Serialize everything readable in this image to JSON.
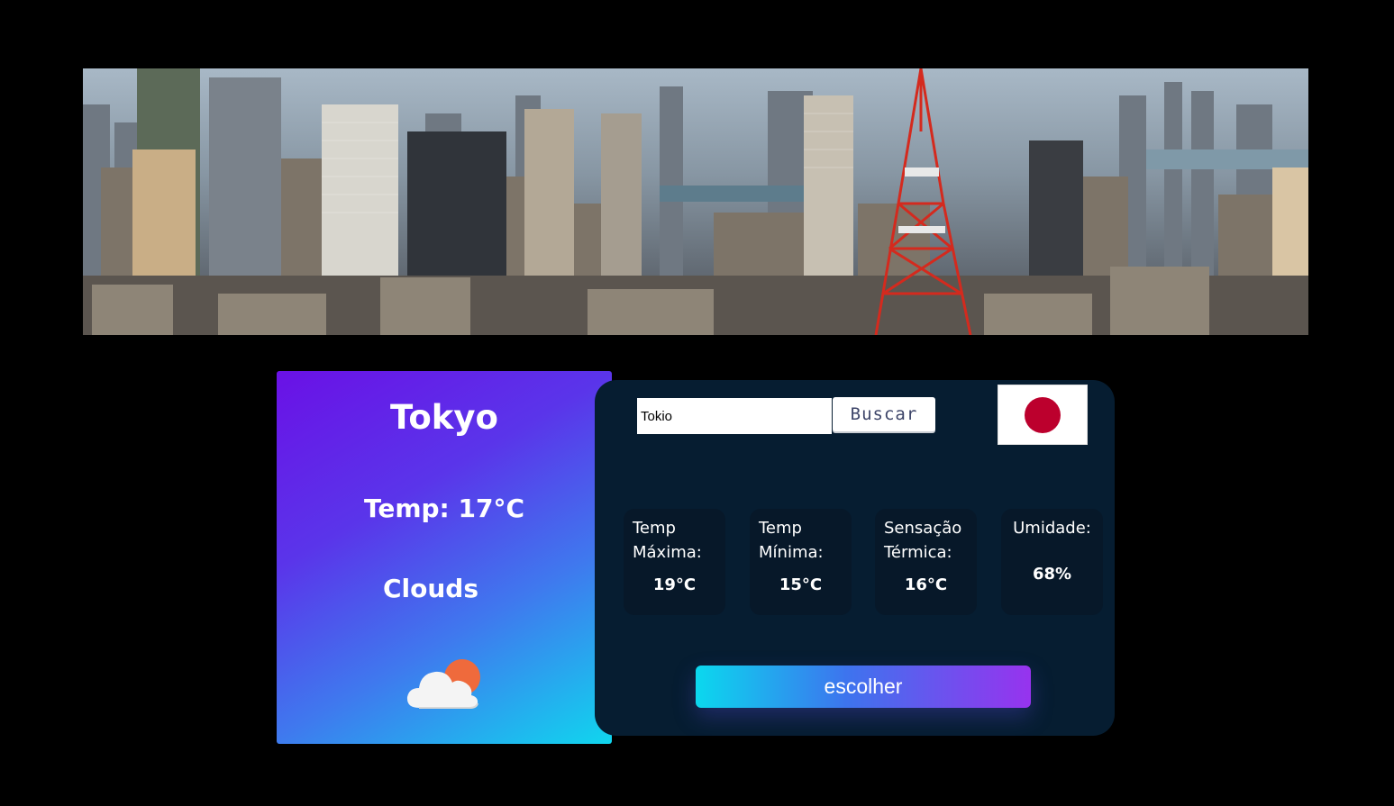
{
  "banner": {
    "alt": "Tokyo skyline"
  },
  "weather": {
    "city": "Tokyo",
    "temp_label": "Temp: 17°C",
    "description": "Clouds",
    "icon": "clouds-sun-icon"
  },
  "search": {
    "value": "Tokio",
    "placeholder": "",
    "button_label": "Buscar"
  },
  "flag": {
    "country": "Japan",
    "icon": "japan-flag-icon",
    "sun_color": "#bc002d"
  },
  "stats": [
    {
      "label": "Temp Máxima:",
      "value": "19°C"
    },
    {
      "label": "Temp Mínima:",
      "value": "15°C"
    },
    {
      "label": "Sensação Térmica:",
      "value": "16°C"
    },
    {
      "label": "Umidade:",
      "value": "68%"
    }
  ],
  "choose_button": {
    "label": "escolher"
  },
  "colors": {
    "panel": "#061d31",
    "stat_card": "#071829",
    "card_gradient_start": "#6a11e6",
    "card_gradient_end": "#10d6ee",
    "button_gradient_start": "#0bd8ee",
    "button_gradient_end": "#9733ee"
  }
}
